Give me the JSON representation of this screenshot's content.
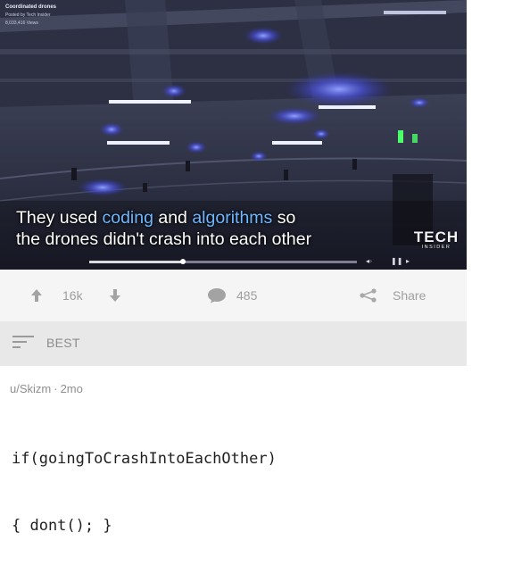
{
  "video": {
    "title": "Coordinated drones",
    "posted_by": "Posted by Tech Insider",
    "views": "8,033,416 Views",
    "caption": {
      "line1_a": "They used ",
      "line1_b": "coding",
      "line1_c": " and ",
      "line1_d": "algorithms",
      "line1_e": " so",
      "line2": "the drones didn't crash into each other"
    },
    "logo_main": "TECH",
    "logo_sub": "INSIDER",
    "progress": 0.35,
    "highlight_color": "#6fb7ff"
  },
  "actions": {
    "upvote_icon": "arrow-up-icon",
    "score": "16k",
    "downvote_icon": "arrow-down-icon",
    "comments_icon": "speech-bubble-icon",
    "comment_count": "485",
    "share_icon": "share-icon",
    "share_label": "Share"
  },
  "sort": {
    "icon": "sort-lines-icon",
    "label": "BEST"
  },
  "comment": {
    "username": "u/Skizm",
    "separator": "·",
    "age": "2mo",
    "line1": "if(goingToCrashIntoEachOther)",
    "line2": "{ dont(); }"
  }
}
